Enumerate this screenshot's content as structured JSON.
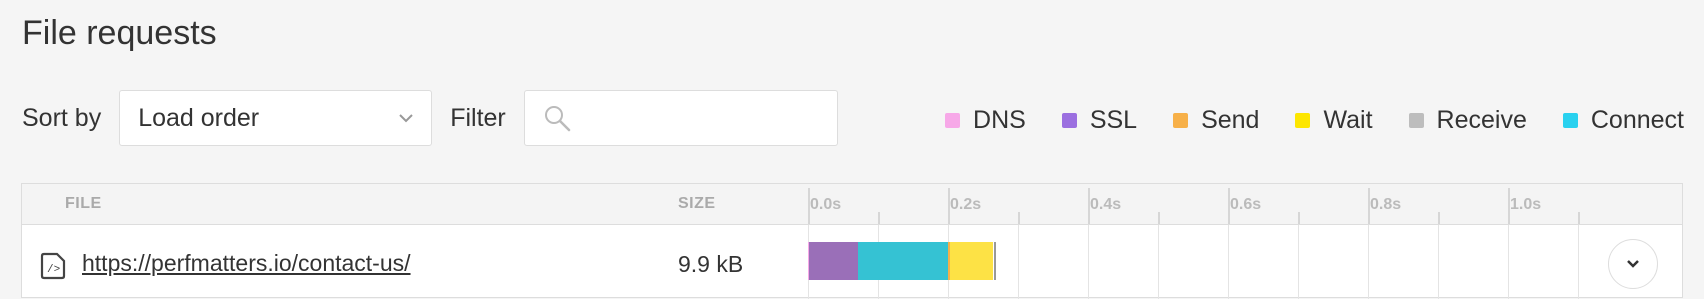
{
  "page": {
    "title": "File requests"
  },
  "controls": {
    "sort_label": "Sort by",
    "sort_value": "Load order",
    "filter_label": "Filter",
    "filter_value": ""
  },
  "legend": [
    {
      "label": "DNS",
      "color": "#f7a8e8"
    },
    {
      "label": "SSL",
      "color": "#9b6fe0"
    },
    {
      "label": "Send",
      "color": "#f7b048"
    },
    {
      "label": "Wait",
      "color": "#fde600"
    },
    {
      "label": "Receive",
      "color": "#bdbdbd"
    },
    {
      "label": "Connect",
      "color": "#29d1ef"
    }
  ],
  "table": {
    "columns": {
      "file": "FILE",
      "size": "SIZE"
    },
    "timeline_ticks": [
      "0.0s",
      "0.2s",
      "0.4s",
      "0.6s",
      "0.8s",
      "1.0s"
    ],
    "rows": [
      {
        "file": "https://perfmatters.io/contact-us/",
        "size": "9.9 kB",
        "segments": [
          {
            "phase": "DNS",
            "start": 0.0,
            "end": 0.002,
            "color": "#f7a8e8"
          },
          {
            "phase": "SSL",
            "start": 0.002,
            "end": 0.072,
            "color": "#9a6fb8"
          },
          {
            "phase": "Connect",
            "start": 0.072,
            "end": 0.2,
            "color": "#35c2d3"
          },
          {
            "phase": "Send",
            "start": 0.2,
            "end": 0.203,
            "color": "#f7b048"
          },
          {
            "phase": "Wait",
            "start": 0.203,
            "end": 0.265,
            "color": "#fde245"
          },
          {
            "phase": "Receive",
            "start": 0.265,
            "end": 0.268,
            "color": "#999999"
          }
        ]
      }
    ]
  },
  "icons": {
    "sort": "chevron-down-icon",
    "filter": "search-icon",
    "file": "code-file-icon",
    "expand": "chevron-down-icon"
  }
}
